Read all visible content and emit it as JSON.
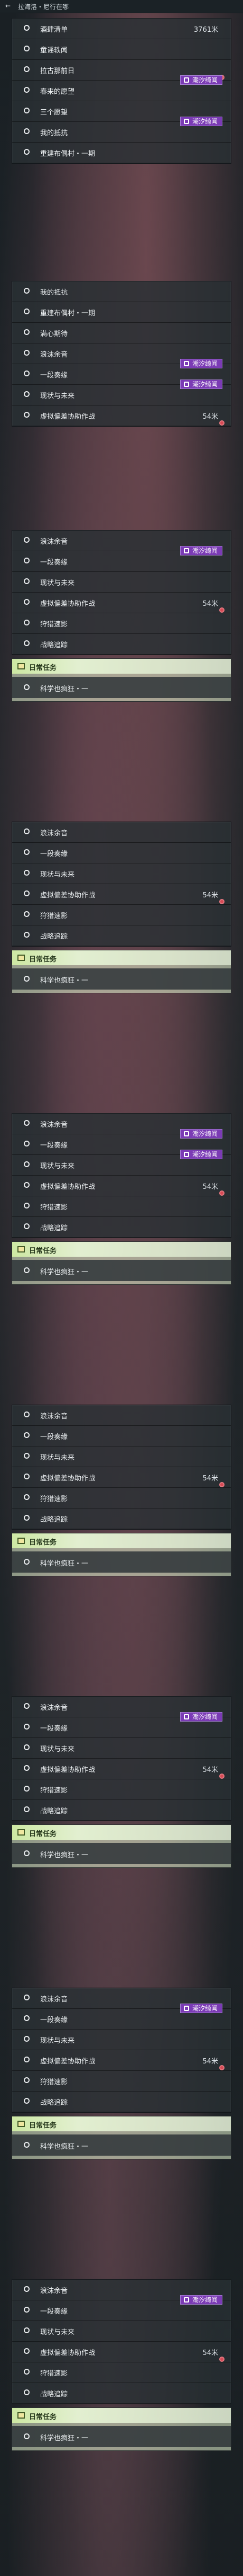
{
  "header": {
    "back_icon": "back-arrow-icon",
    "title": "拉海洛・尼行在哪"
  },
  "section1": [
    {
      "label": "酒肆清单",
      "value": "3761米",
      "tag": "",
      "dot": false
    },
    {
      "label": "童谣轶闻",
      "value": "",
      "tag": "",
      "dot": false
    },
    {
      "label": "拉古那前日",
      "value": "",
      "tag": "",
      "dot": true
    },
    {
      "label": "春来的愿望",
      "value": "",
      "tag": "潮汐绮闻",
      "dot": false
    },
    {
      "label": "三个愿望",
      "value": "",
      "tag": "",
      "dot": false
    },
    {
      "label": "我的抵抗",
      "value": "",
      "tag": "潮汐绮闻",
      "dot": false
    },
    {
      "label": "重建布偶村・一期",
      "value": "",
      "tag": "",
      "dot": false
    }
  ],
  "section2": [
    {
      "label": "我的抵抗",
      "value": "",
      "tag": "",
      "dot": false
    },
    {
      "label": "重建布偶村・一期",
      "value": "",
      "tag": "",
      "dot": false
    },
    {
      "label": "满心期待",
      "value": "",
      "tag": "",
      "dot": false
    },
    {
      "label": "浪沫余音",
      "value": "",
      "tag": "",
      "dot": false
    },
    {
      "label": "一段奏缘",
      "value": "",
      "tag": "潮汐绮闻",
      "dot": false
    },
    {
      "label": "现状与未来",
      "value": "",
      "tag": "潮汐绮闻",
      "dot": false
    },
    {
      "label": "虚拟偏差协助作战",
      "value": "54米",
      "tag": "",
      "dot": true
    }
  ],
  "blocks": [
    {
      "items": [
        {
          "label": "浪沫余音",
          "value": "",
          "tag": "",
          "dot": false
        },
        {
          "label": "一段奏缘",
          "value": "",
          "tag": "潮汐绮闻",
          "dot": false
        },
        {
          "label": "现状与未来",
          "value": "",
          "tag": "",
          "dot": false
        },
        {
          "label": "虚拟偏差协助作战",
          "value": "54米",
          "tag": "",
          "dot": true
        },
        {
          "label": "狩猎速影",
          "value": "",
          "tag": "",
          "dot": false
        },
        {
          "label": "战略追踪",
          "value": "",
          "tag": "",
          "dot": false
        }
      ],
      "daily_title": "日常任务",
      "daily_item": "科学也疯狂・一"
    },
    {
      "items": [
        {
          "label": "浪沫余音",
          "value": "",
          "tag": "",
          "dot": false
        },
        {
          "label": "一段奏缘",
          "value": "",
          "tag": "",
          "dot": false
        },
        {
          "label": "现状与未来",
          "value": "",
          "tag": "",
          "dot": false
        },
        {
          "label": "虚拟偏差协助作战",
          "value": "54米",
          "tag": "",
          "dot": true
        },
        {
          "label": "狩猎速影",
          "value": "",
          "tag": "",
          "dot": false
        },
        {
          "label": "战略追踪",
          "value": "",
          "tag": "",
          "dot": false
        }
      ],
      "daily_title": "日常任务",
      "daily_item": "科学也疯狂・一"
    },
    {
      "items": [
        {
          "label": "浪沫余音",
          "value": "",
          "tag": "",
          "dot": false
        },
        {
          "label": "一段奏缘",
          "value": "",
          "tag": "潮汐绮闻",
          "dot": false
        },
        {
          "label": "现状与未来",
          "value": "",
          "tag": "潮汐绮闻",
          "dot": false
        },
        {
          "label": "虚拟偏差协助作战",
          "value": "54米",
          "tag": "",
          "dot": true
        },
        {
          "label": "狩猎速影",
          "value": "",
          "tag": "",
          "dot": false
        },
        {
          "label": "战略追踪",
          "value": "",
          "tag": "",
          "dot": false
        }
      ],
      "daily_title": "日常任务",
      "daily_item": "科学也疯狂・一"
    },
    {
      "items": [
        {
          "label": "浪沫余音",
          "value": "",
          "tag": "",
          "dot": false
        },
        {
          "label": "一段奏缘",
          "value": "",
          "tag": "",
          "dot": false
        },
        {
          "label": "现状与未来",
          "value": "",
          "tag": "",
          "dot": false
        },
        {
          "label": "虚拟偏差协助作战",
          "value": "54米",
          "tag": "",
          "dot": true
        },
        {
          "label": "狩猎速影",
          "value": "",
          "tag": "",
          "dot": false
        },
        {
          "label": "战略追踪",
          "value": "",
          "tag": "",
          "dot": false
        }
      ],
      "daily_title": "日常任务",
      "daily_item": "科学也疯狂・一"
    },
    {
      "items": [
        {
          "label": "浪沫余音",
          "value": "",
          "tag": "",
          "dot": false
        },
        {
          "label": "一段奏缘",
          "value": "",
          "tag": "潮汐绮闻",
          "dot": false
        },
        {
          "label": "现状与未来",
          "value": "",
          "tag": "",
          "dot": false
        },
        {
          "label": "虚拟偏差协助作战",
          "value": "54米",
          "tag": "",
          "dot": true
        },
        {
          "label": "狩猎速影",
          "value": "",
          "tag": "",
          "dot": false
        },
        {
          "label": "战略追踪",
          "value": "",
          "tag": "",
          "dot": false
        }
      ],
      "daily_title": "日常任务",
      "daily_item": "科学也疯狂・一"
    },
    {
      "items": [
        {
          "label": "浪沫余音",
          "value": "",
          "tag": "",
          "dot": false
        },
        {
          "label": "一段奏缘",
          "value": "",
          "tag": "潮汐绮闻",
          "dot": false
        },
        {
          "label": "现状与未来",
          "value": "",
          "tag": "",
          "dot": false
        },
        {
          "label": "虚拟偏差协助作战",
          "value": "54米",
          "tag": "",
          "dot": true
        },
        {
          "label": "狩猎速影",
          "value": "",
          "tag": "",
          "dot": false
        },
        {
          "label": "战略追踪",
          "value": "",
          "tag": "",
          "dot": false
        }
      ],
      "daily_title": "日常任务",
      "daily_item": "科学也疯狂・一"
    },
    {
      "items": [
        {
          "label": "浪沫余音",
          "value": "",
          "tag": "",
          "dot": false
        },
        {
          "label": "一段奏缘",
          "value": "",
          "tag": "潮汐绮闻",
          "dot": false
        },
        {
          "label": "现状与未来",
          "value": "",
          "tag": "",
          "dot": false
        },
        {
          "label": "虚拟偏差协助作战",
          "value": "54米",
          "tag": "",
          "dot": true
        },
        {
          "label": "狩猎速影",
          "value": "",
          "tag": "",
          "dot": false
        },
        {
          "label": "战略追踪",
          "value": "",
          "tag": "",
          "dot": false
        }
      ],
      "daily_title": "日常任务",
      "daily_item": "科学也疯狂・一"
    }
  ],
  "colors": {
    "tag_bg": "#7b3bb5",
    "dot": "#d74a55",
    "daily_bg": "#cde8a3"
  }
}
